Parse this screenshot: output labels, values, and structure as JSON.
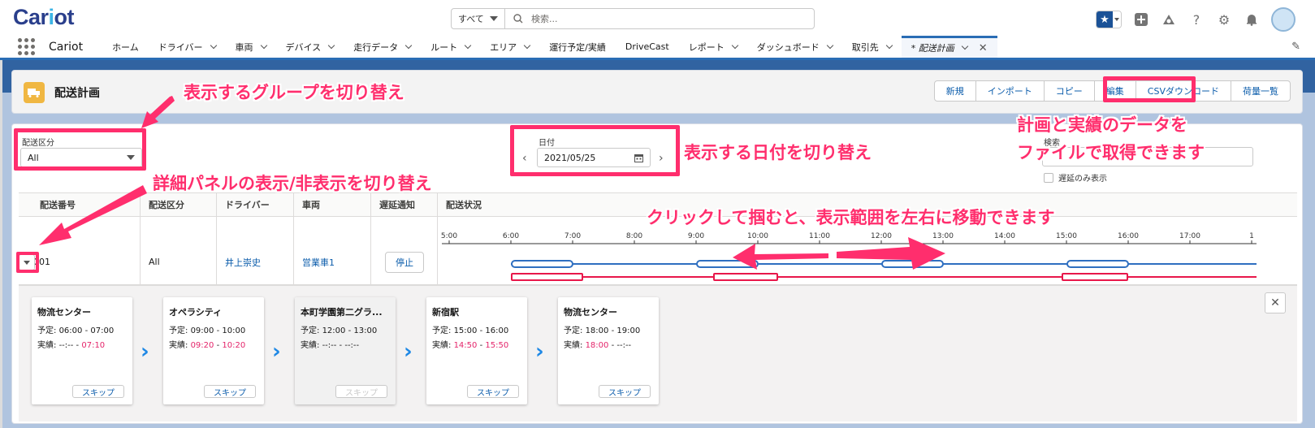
{
  "header": {
    "logo": "Cariot",
    "search_scope": "すべて",
    "search_placeholder": "検索..."
  },
  "nav": {
    "app_name": "Cariot",
    "items": [
      {
        "label": "ホーム",
        "has_menu": false
      },
      {
        "label": "ドライバー",
        "has_menu": true
      },
      {
        "label": "車両",
        "has_menu": true
      },
      {
        "label": "デバイス",
        "has_menu": true
      },
      {
        "label": "走行データ",
        "has_menu": true
      },
      {
        "label": "ルート",
        "has_menu": true
      },
      {
        "label": "エリア",
        "has_menu": true
      },
      {
        "label": "運行予定/実績",
        "has_menu": false
      },
      {
        "label": "DriveCast",
        "has_menu": false
      },
      {
        "label": "レポート",
        "has_menu": true
      },
      {
        "label": "ダッシュボード",
        "has_menu": true
      },
      {
        "label": "取引先",
        "has_menu": true
      }
    ],
    "active_tab": "* 配送計画"
  },
  "page": {
    "title": "配送計画",
    "buttons": [
      "新規",
      "インポート",
      "コピー",
      "編集",
      "CSVダウンロード",
      "荷量一覧"
    ]
  },
  "filters": {
    "category_label": "配送区分",
    "category_value": "All",
    "date_label": "日付",
    "date_value": "2021/05/25",
    "search_label": "検索",
    "late_only_label": "遅延のみ表示"
  },
  "table": {
    "headers": [
      "配送番号",
      "配送区分",
      "ドライバー",
      "車両",
      "遅延通知",
      "配送状況"
    ],
    "row": {
      "number": "001",
      "category": "All",
      "driver": "井上崇史",
      "vehicle": "営業車1",
      "stop_label": "停止"
    },
    "timeline_ticks": [
      "5:00",
      "6:00",
      "7:00",
      "8:00",
      "9:00",
      "10:00",
      "11:00",
      "12:00",
      "13:00",
      "14:00",
      "15:00",
      "16:00",
      "17:00",
      "1"
    ]
  },
  "stops": [
    {
      "name": "物流センター",
      "plan_label": "予定:",
      "plan_start": "06:00",
      "plan_end": "07:00",
      "actual_label": "実績:",
      "actual_start": "--:--",
      "actual_end": "07:10",
      "skip": "スキップ",
      "disabled": false
    },
    {
      "name": "オペラシティ",
      "plan_label": "予定:",
      "plan_start": "09:00",
      "plan_end": "10:00",
      "actual_label": "実績:",
      "actual_start": "09:20",
      "actual_end": "10:20",
      "skip": "スキップ",
      "disabled": false
    },
    {
      "name": "本町学園第二グラ...",
      "plan_label": "予定:",
      "plan_start": "12:00",
      "plan_end": "13:00",
      "actual_label": "実績:",
      "actual_start": "--:--",
      "actual_end": "--:--",
      "skip": "スキップ",
      "disabled": true
    },
    {
      "name": "新宿駅",
      "plan_label": "予定:",
      "plan_start": "15:00",
      "plan_end": "16:00",
      "actual_label": "実績:",
      "actual_start": "14:50",
      "actual_end": "15:50",
      "skip": "スキップ",
      "disabled": false
    },
    {
      "name": "物流センター",
      "plan_label": "予定:",
      "plan_start": "18:00",
      "plan_end": "19:00",
      "actual_label": "実績:",
      "actual_start": "18:00",
      "actual_end": "--:--",
      "skip": "スキップ",
      "disabled": false
    }
  ],
  "annotations": {
    "group": "表示するグループを切り替え",
    "date": "表示する日付を切り替え",
    "detail": "詳細パネルの表示/非表示を切り替え",
    "csv_line1": "計画と実績のデータを",
    "csv_line2": "ファイルで取得できます",
    "drag": "クリックして掴むと、表示範囲を左右に移動できます"
  },
  "colors": {
    "brand": "#1b5297",
    "annotation": "#ff2e6d",
    "plan_bar": "#2f6fc0",
    "actual_bar": "#e8174a",
    "link": "#0b5cab"
  }
}
